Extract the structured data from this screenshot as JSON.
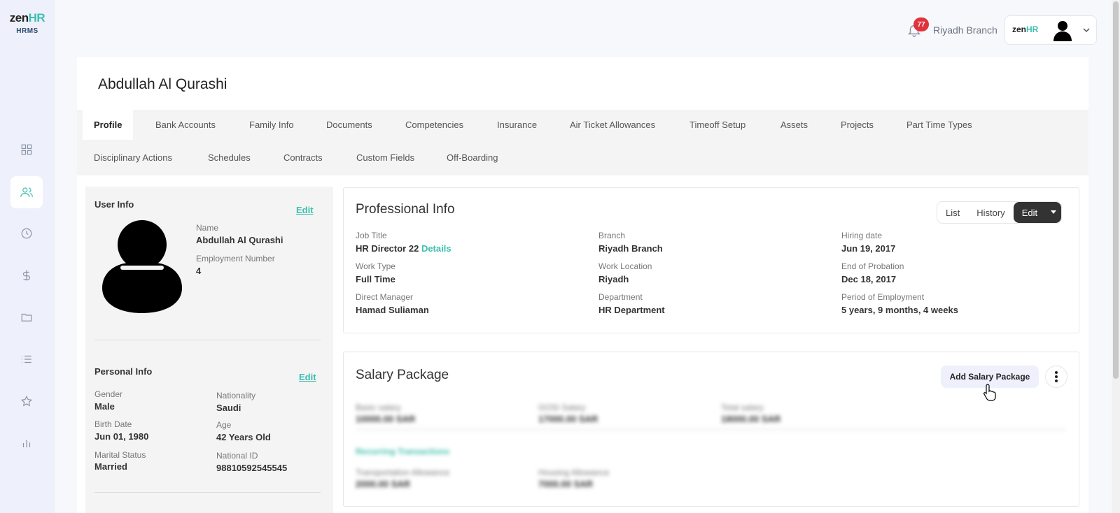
{
  "brand": {
    "word": "zen",
    "word_accent": "HR",
    "sub": "HRMS"
  },
  "sidebar": {
    "items": [
      {
        "name": "dashboard",
        "icon": "grid-icon"
      },
      {
        "name": "employees",
        "icon": "users-icon",
        "active": true
      },
      {
        "name": "time",
        "icon": "clock-icon"
      },
      {
        "name": "payroll",
        "icon": "dollar-icon"
      },
      {
        "name": "documents",
        "icon": "folder-icon"
      },
      {
        "name": "lists",
        "icon": "list-icon"
      },
      {
        "name": "favorites",
        "icon": "star-icon"
      },
      {
        "name": "reports",
        "icon": "bar-chart-icon"
      }
    ]
  },
  "topbar": {
    "notifications": "77",
    "branch": "Riyadh Branch",
    "switch_logo_word": "zen",
    "switch_logo_accent": "HR"
  },
  "employee": {
    "name": "Abdullah Al Qurashi"
  },
  "tabs": [
    "Profile",
    "Bank Accounts",
    "Family Info",
    "Documents",
    "Competencies",
    "Insurance",
    "Air Ticket Allowances",
    "Timeoff Setup",
    "Assets",
    "Projects",
    "Part Time Types",
    "Disciplinary Actions",
    "Schedules",
    "Contracts",
    "Custom Fields",
    "Off-Boarding"
  ],
  "user_info": {
    "title": "User Info",
    "edit": "Edit",
    "name_label": "Name",
    "name_value": "Abdullah Al Qurashi",
    "emp_label": "Employment Number",
    "emp_value": "4"
  },
  "personal_info": {
    "title": "Personal Info",
    "edit": "Edit",
    "gender_label": "Gender",
    "gender_value": "Male",
    "nationality_label": "Nationality",
    "nationality_value": "Saudi",
    "birth_label": "Birth Date",
    "birth_value": "Jun 01, 1980",
    "age_label": "Age",
    "age_value": "42 Years Old",
    "marital_label": "Marital Status",
    "marital_value": "Married",
    "nid_label": "National ID",
    "nid_value": "98810592545545"
  },
  "professional_info": {
    "title": "Professional Info",
    "buttons": {
      "list": "List",
      "history": "History",
      "edit": "Edit"
    },
    "job_title_label": "Job Title",
    "job_title_value": "HR Director 22",
    "details": "Details",
    "branch_label": "Branch",
    "branch_value": "Riyadh Branch",
    "hiring_label": "Hiring date",
    "hiring_value": "Jun 19, 2017",
    "work_type_label": "Work Type",
    "work_type_value": "Full Time",
    "work_location_label": "Work Location",
    "work_location_value": "Riyadh",
    "probation_label": "End of Probation",
    "probation_value": "Dec 18, 2017",
    "manager_label": "Direct Manager",
    "manager_value": "Hamad Suliaman",
    "department_label": "Department",
    "department_value": "HR Department",
    "period_label": "Period of Employment",
    "period_value": "5 years, 9 months, 4 weeks"
  },
  "salary_package": {
    "title": "Salary Package",
    "add_button": "Add Salary Package",
    "blurred": {
      "basic_label": "Basic salary",
      "basic_value": "10000.00 SAR",
      "gosi_label": "GOSI Salary",
      "gosi_value": "17000.00 SAR",
      "total_label": "Total salary",
      "total_value": "18000.00 SAR",
      "recurring": "Recurring Transactions",
      "transport_label": "Transportation Allowance",
      "transport_value": "2000.00 SAR",
      "housing_label": "Housing Allowance",
      "housing_value": "7000.00 SAR"
    }
  }
}
